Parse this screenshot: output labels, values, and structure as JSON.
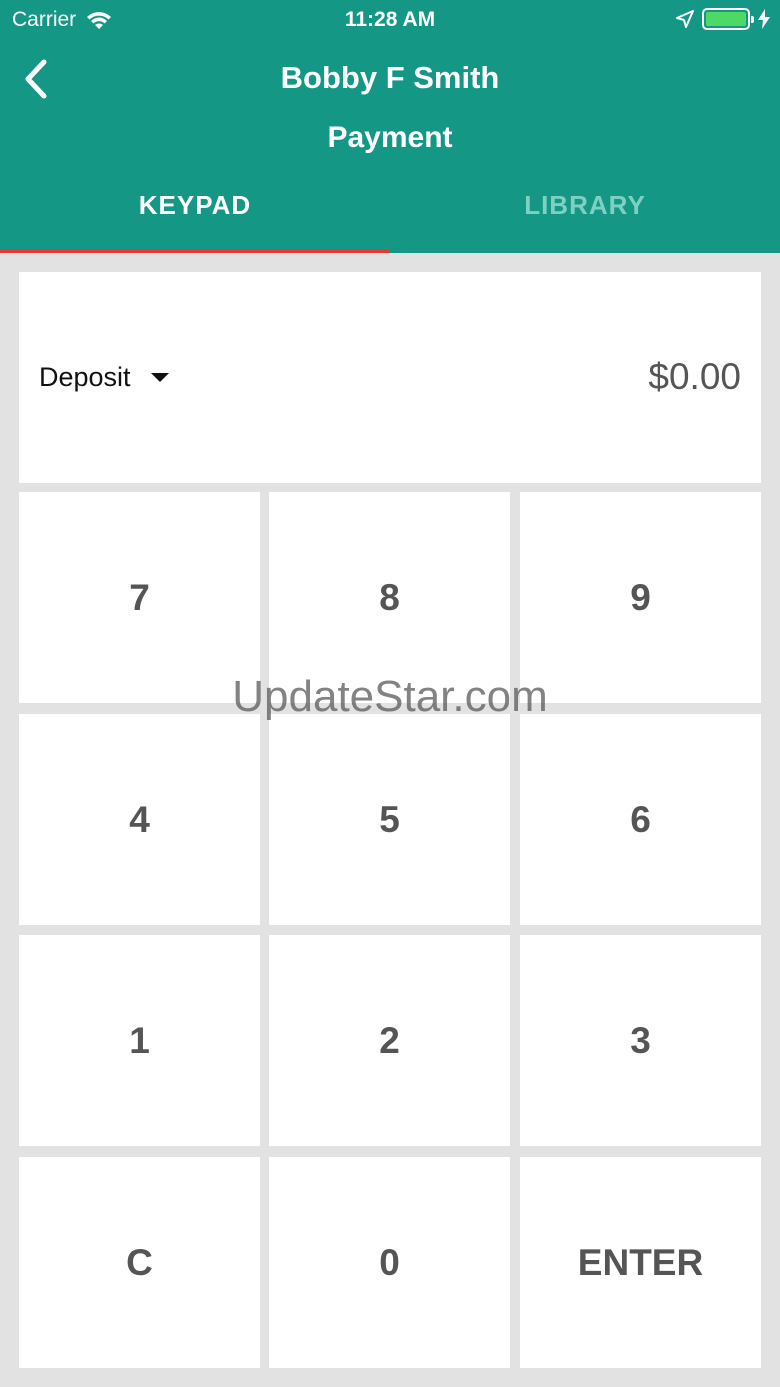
{
  "status_bar": {
    "carrier": "Carrier",
    "time": "11:28 AM"
  },
  "header": {
    "title": "Bobby F Smith",
    "subtitle": "Payment",
    "background_color": "#159786"
  },
  "tabs": [
    {
      "label": "KEYPAD",
      "active": true
    },
    {
      "label": "LIBRARY",
      "active": false
    }
  ],
  "display": {
    "type_label": "Deposit",
    "amount": "$0.00"
  },
  "keypad": {
    "keys": [
      "7",
      "8",
      "9",
      "4",
      "5",
      "6",
      "1",
      "2",
      "3",
      "C",
      "0",
      "ENTER"
    ]
  },
  "watermark": "UpdateStar.com"
}
